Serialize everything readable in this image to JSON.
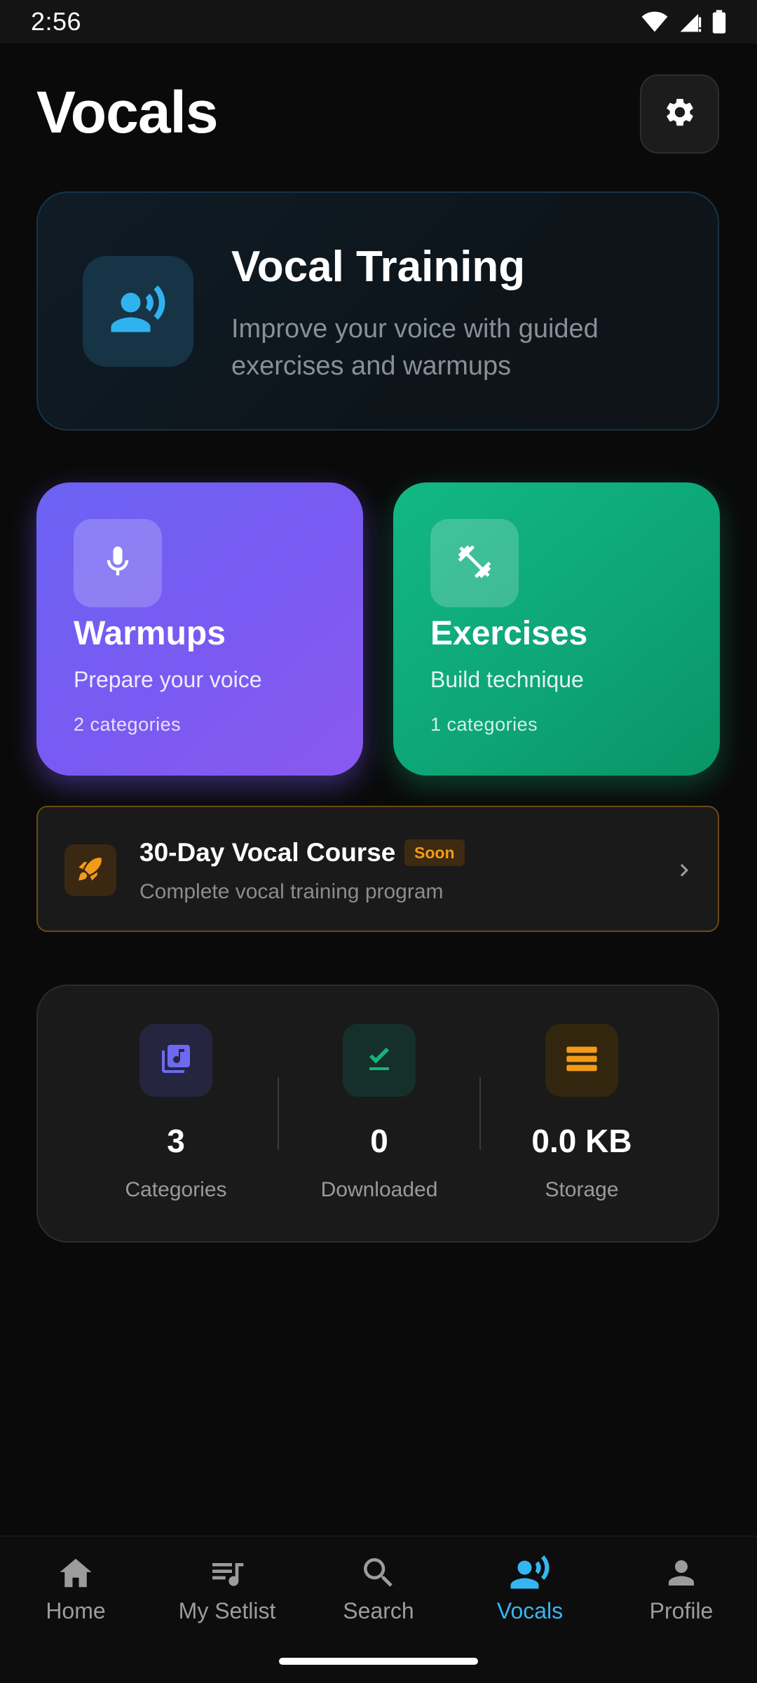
{
  "status_bar": {
    "time": "2:56"
  },
  "header": {
    "title": "Vocals"
  },
  "hero": {
    "title": "Vocal Training",
    "subtitle": "Improve your voice with guided exercises and warmups",
    "icon": "voice-speaking-icon"
  },
  "categories": [
    {
      "title": "Warmups",
      "subtitle": "Prepare your voice",
      "count": "2 categories",
      "icon": "microphone-icon",
      "color": "#7a5af2"
    },
    {
      "title": "Exercises",
      "subtitle": "Build technique",
      "count": "1 categories",
      "icon": "dumbbell-icon",
      "color": "#0ea676"
    }
  ],
  "course": {
    "title": "30-Day Vocal Course",
    "badge": "Soon",
    "subtitle": "Complete vocal training program",
    "icon": "rocket-icon",
    "accent": "#f29b19"
  },
  "stats": [
    {
      "value": "3",
      "label": "Categories",
      "icon": "library-music-icon",
      "color": "#6d6af0"
    },
    {
      "value": "0",
      "label": "Downloaded",
      "icon": "download-done-icon",
      "color": "#17b37b"
    },
    {
      "value": "0.0 KB",
      "label": "Storage",
      "icon": "storage-icon",
      "color": "#f29b19"
    }
  ],
  "nav": {
    "items": [
      {
        "label": "Home",
        "icon": "home-icon"
      },
      {
        "label": "My Setlist",
        "icon": "queue-music-icon"
      },
      {
        "label": "Search",
        "icon": "search-icon"
      },
      {
        "label": "Vocals",
        "icon": "voice-speaking-icon"
      },
      {
        "label": "Profile",
        "icon": "person-icon"
      }
    ],
    "active": "Vocals",
    "active_color": "#35b6f2"
  }
}
